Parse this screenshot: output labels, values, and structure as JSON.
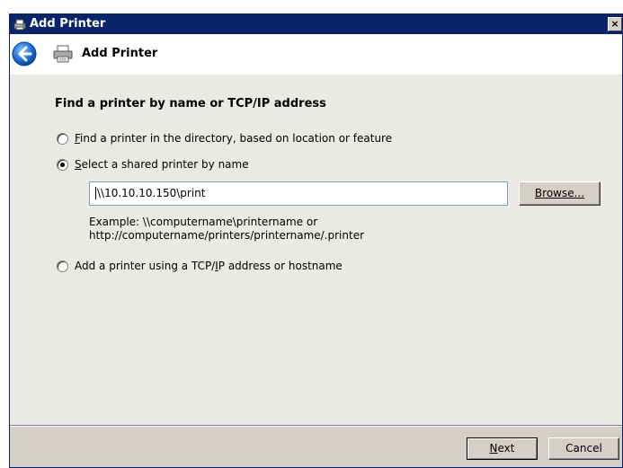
{
  "window": {
    "title": "Add Printer",
    "close_glyph": "×"
  },
  "header": {
    "title": "Add Printer",
    "back_icon": "back-arrow-icon",
    "printer_icon": "printer-icon"
  },
  "content": {
    "heading": "Find a printer by name or TCP/IP address",
    "options": [
      {
        "prefix": "",
        "accel": "F",
        "rest": "ind a printer in the directory, based on location or feature",
        "checked": false
      },
      {
        "prefix": "",
        "accel": "S",
        "rest": "elect a shared printer by name",
        "checked": true
      },
      {
        "prefix": "Add a printer using a TCP/",
        "accel": "I",
        "rest": "P address or hostname",
        "checked": false
      }
    ],
    "printer_path": "\\\\10.10.10.150\\print",
    "browse_label": "Browse...",
    "example_line1": "Example: \\\\computername\\printername or",
    "example_line2": "http://computername/printers/printername/.printer"
  },
  "footer": {
    "next_accel": "N",
    "next_rest": "ext",
    "cancel_label": "Cancel"
  },
  "colors": {
    "titlebar": "#0a246a",
    "back_button": "#1c6fd6"
  }
}
